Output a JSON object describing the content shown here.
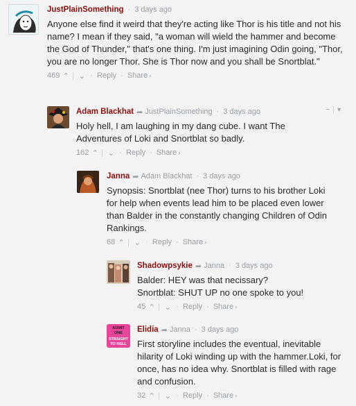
{
  "comments": [
    {
      "author": "JustPlainSomething",
      "reply_to": "",
      "time": "3 days ago",
      "text": "Anyone else find it weird that they're acting like Thor is his title and not his name? I mean if they said, \"a woman will wield the hammer and become the God of Thunder,\" that's one thing. I'm just imagining Odin going, \"Thor, you are no longer Thor. She is Thor now and you shall be Snortblat.\"",
      "votes": "469",
      "reply_label": "Reply",
      "share_label": "Share"
    },
    {
      "author": "Adam Blackhat",
      "reply_to": "JustPlainSomething",
      "time": "3 days ago",
      "text": "Holy hell, I am laughing in my dang cube. I want The Adventures of Loki and Snortblat so badly.",
      "votes": "162",
      "reply_label": "Reply",
      "share_label": "Share",
      "collapse_label": "−"
    },
    {
      "author": "Janna",
      "reply_to": "Adam Blackhat",
      "time": "3 days ago",
      "text": "Synopsis: Snortblat (nee Thor) turns to his brother Loki for help when events lead him to be placed even lower than Balder in the constantly changing Children of Odin Rankings.",
      "votes": "68",
      "reply_label": "Reply",
      "share_label": "Share"
    },
    {
      "author": "Shadowpsykie",
      "reply_to": "Janna",
      "time": "3 days ago",
      "text_lines": [
        "Balder: HEY was that necissary?",
        "Snortblat: SHUT UP no one spoke to you!"
      ],
      "votes": "45",
      "reply_label": "Reply",
      "share_label": "Share"
    },
    {
      "author": "Elidia",
      "reply_to": "Janna",
      "time": "3 days ago",
      "text": "First storyline includes the eventual, inevitable hilarity of Loki winding up with the hammer.Loki, for once, has no idea why. Snortblat is filled with rage and confusion.",
      "votes": "32",
      "reply_label": "Reply",
      "share_label": "Share",
      "avatar_text": [
        "ADMIT",
        "ONE",
        "STRAIGHT",
        "TO HELL"
      ]
    }
  ],
  "colors": {
    "author": "#8b0d0d",
    "meta": "#9aa0a6",
    "text": "#2a2a2a",
    "background": "#f3f3f3"
  }
}
